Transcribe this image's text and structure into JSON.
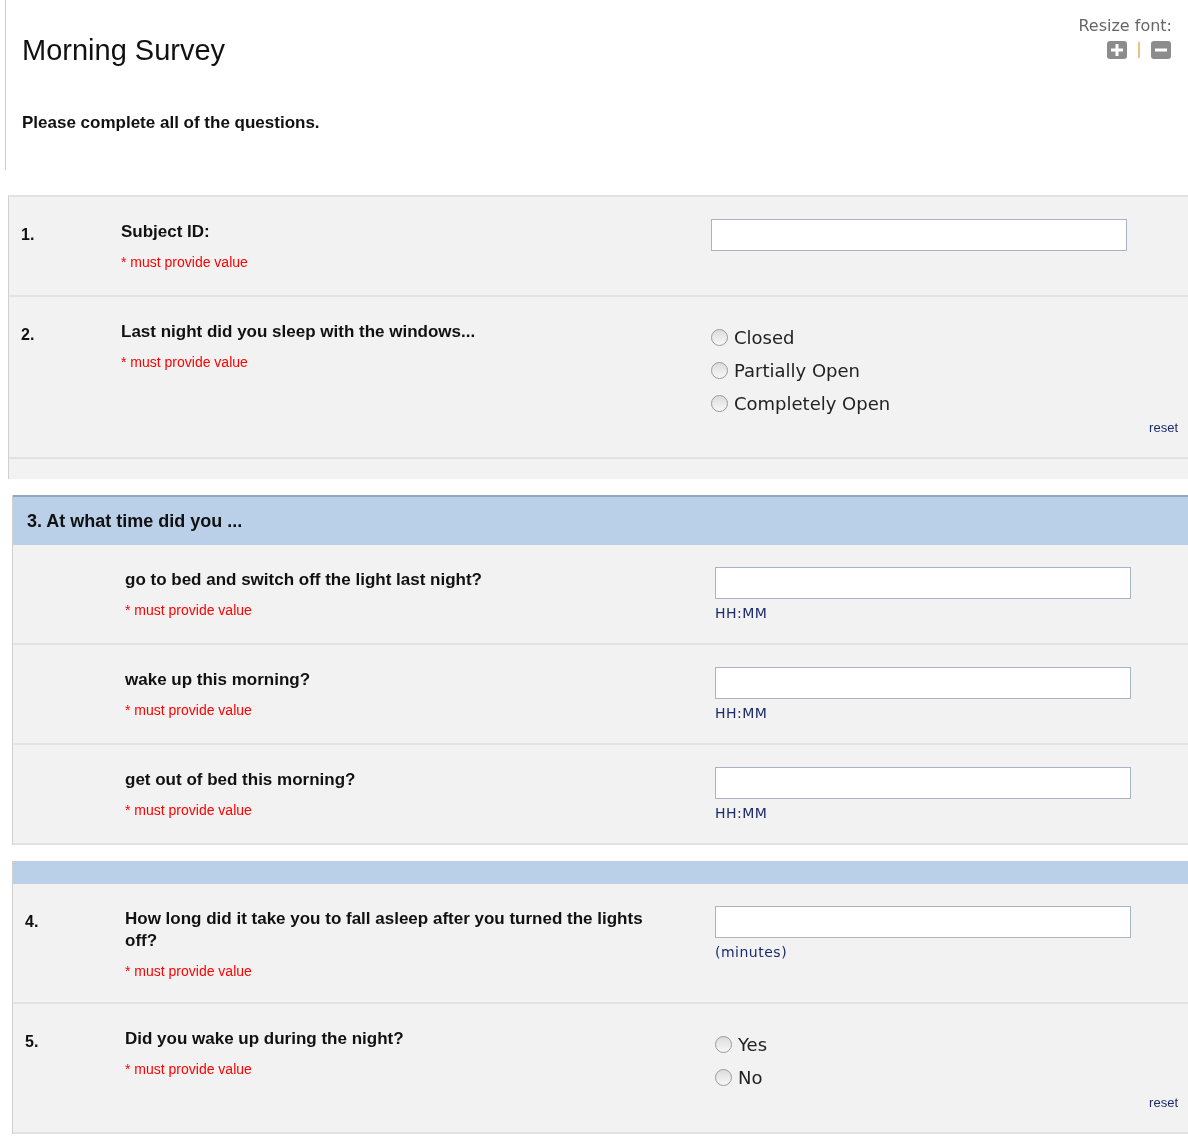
{
  "header": {
    "title": "Morning Survey",
    "instructions": "Please complete all of the questions.",
    "resize_font": {
      "label": "Resize font:"
    }
  },
  "sections": [
    {
      "items": [
        {
          "kind": "text",
          "number": "1.",
          "question": "Subject ID:",
          "note": "* must provide value"
        },
        {
          "kind": "radio",
          "number": "2.",
          "question": "Last night did you sleep with the windows...",
          "note": "* must provide value",
          "options": [
            {
              "label": "Closed",
              "selected": false
            },
            {
              "label": "Partially Open",
              "selected": false
            },
            {
              "label": "Completely Open",
              "selected": false
            }
          ],
          "reset": "reset"
        }
      ]
    },
    {
      "heading": "3. At what time did you ...",
      "items": [
        {
          "kind": "text",
          "question": "go to bed and switch off the light last night?",
          "note": "* must provide value",
          "hint": "HH:MM"
        },
        {
          "kind": "text",
          "question": "wake up this morning?",
          "note": "* must provide value",
          "hint": "HH:MM"
        },
        {
          "kind": "text",
          "question": "get out of bed this morning?",
          "note": "* must provide value",
          "hint": "HH:MM"
        }
      ]
    },
    {
      "band": true,
      "items": [
        {
          "kind": "text",
          "number": "4.",
          "question": "How long did it take you to fall asleep after you turned the lights off?",
          "note": "* must provide value",
          "hint": "(minutes)"
        },
        {
          "kind": "radio",
          "number": "5.",
          "question": "Did you wake up during the night?",
          "note": "* must provide value",
          "options": [
            {
              "label": "Yes",
              "selected": false
            },
            {
              "label": "No",
              "selected": false
            }
          ],
          "reset": "reset"
        }
      ]
    }
  ]
}
